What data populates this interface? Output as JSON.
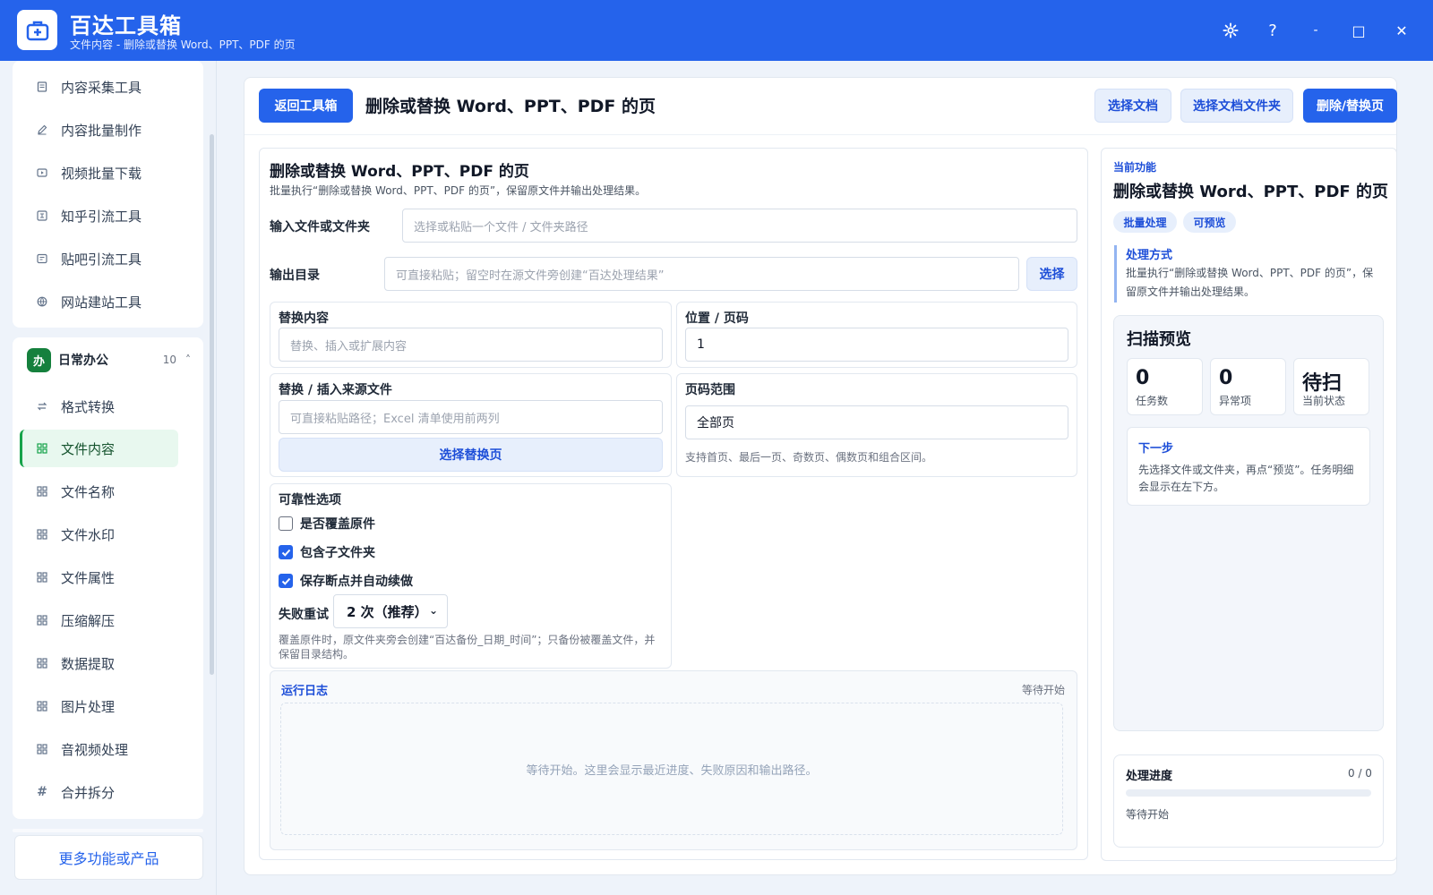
{
  "app": {
    "title": "百达工具箱",
    "subtitle": "文件内容 - 删除或替换 Word、PPT、PDF 的页",
    "accent": "#2563eb"
  },
  "window_controls": {
    "settings_icon": "gear-icon",
    "help_label": "?",
    "minimize_label": "-",
    "maximize_label": "□",
    "close_label": "✕"
  },
  "sidebar": {
    "top_items": [
      {
        "label": "内容采集工具",
        "icon": "document-icon"
      },
      {
        "label": "内容批量制作",
        "icon": "pencil-icon"
      },
      {
        "label": "视频批量下载",
        "icon": "video-icon"
      },
      {
        "label": "知乎引流工具",
        "icon": "zhihu-icon"
      },
      {
        "label": "贴吧引流工具",
        "icon": "forum-icon"
      },
      {
        "label": "网站建站工具",
        "icon": "globe-icon"
      }
    ],
    "group": {
      "badge": "办",
      "title": "日常办公",
      "count": "10",
      "caret": "˄"
    },
    "group_items": [
      {
        "label": "格式转换",
        "icon": "swap-icon"
      },
      {
        "label": "文件内容",
        "icon": "grid-icon"
      },
      {
        "label": "文件名称",
        "icon": "grid-icon"
      },
      {
        "label": "文件水印",
        "icon": "grid-icon"
      },
      {
        "label": "文件属性",
        "icon": "grid-icon"
      },
      {
        "label": "压缩解压",
        "icon": "grid-icon"
      },
      {
        "label": "数据提取",
        "icon": "grid-icon"
      },
      {
        "label": "图片处理",
        "icon": "grid-icon"
      },
      {
        "label": "音视频处理",
        "icon": "grid-icon"
      },
      {
        "label": "合并拆分",
        "icon": "hash-icon"
      }
    ],
    "active_item": "文件内容",
    "more_label": "更多功能或产品"
  },
  "header": {
    "back_label": "返回工具箱",
    "title": "删除或替换 Word、PPT、PDF 的页",
    "choose_doc_label": "选择文档",
    "choose_folder_label": "选择文档文件夹",
    "run_label": "删除/替换页"
  },
  "form": {
    "title": "删除或替换 Word、PPT、PDF 的页",
    "description": "批量执行“删除或替换 Word、PPT、PDF 的页”，保留原文件并输出处理结果。",
    "input_label": "输入文件或文件夹",
    "input_placeholder": "选择或粘贴一个文件 / 文件夹路径",
    "output_label": "输出目录",
    "output_placeholder": "可直接粘贴；留空时在源文件旁创建“百达处理结果”",
    "output_choose_label": "选择",
    "replace_content_label": "替换内容",
    "replace_content_placeholder": "替换、插入或扩展内容",
    "position_label": "位置 / 页码",
    "position_value": "1",
    "source_label": "替换 / 插入来源文件",
    "source_placeholder": "可直接粘贴路径；Excel 清单使用前两列",
    "source_choose_label": "选择替换页",
    "range_label": "页码范围",
    "range_value": "全部页",
    "range_hint": "支持首页、最后一页、奇数页、偶数页和组合区间。",
    "reliability_label": "可靠性选项",
    "options": [
      {
        "label": "是否覆盖原件",
        "checked": false
      },
      {
        "label": "包含子文件夹",
        "checked": true
      },
      {
        "label": "保存断点并自动续做",
        "checked": true
      }
    ],
    "retry_label": "失败重试",
    "retry_value": "2 次（推荐）",
    "backup_hint": "覆盖原件时，原文件夹旁会创建“百达备份_日期_时间”；只备份被覆盖文件，并保留目录结构。"
  },
  "log": {
    "title": "运行日志",
    "status": "等待开始",
    "empty_text": "等待开始。这里会显示最近进度、失败原因和输出路径。"
  },
  "info": {
    "current_label": "当前功能",
    "title": "删除或替换 Word、PPT、PDF 的页",
    "tags": [
      "批量处理",
      "可预览"
    ],
    "method_title": "处理方式",
    "method_desc": "批量执行“删除或替换 Word、PPT、PDF 的页”，保留原文件并输出处理结果。"
  },
  "scan": {
    "title": "扫描预览",
    "stats": [
      {
        "value": "0",
        "label": "任务数"
      },
      {
        "value": "0",
        "label": "异常项"
      },
      {
        "value": "待扫",
        "label": "当前状态"
      }
    ],
    "next_title": "下一步",
    "next_desc": "先选择文件或文件夹，再点“预览”。任务明细会显示在左下方。"
  },
  "progress": {
    "title": "处理进度",
    "count": "0 / 0",
    "fraction": 0,
    "status": "等待开始"
  }
}
